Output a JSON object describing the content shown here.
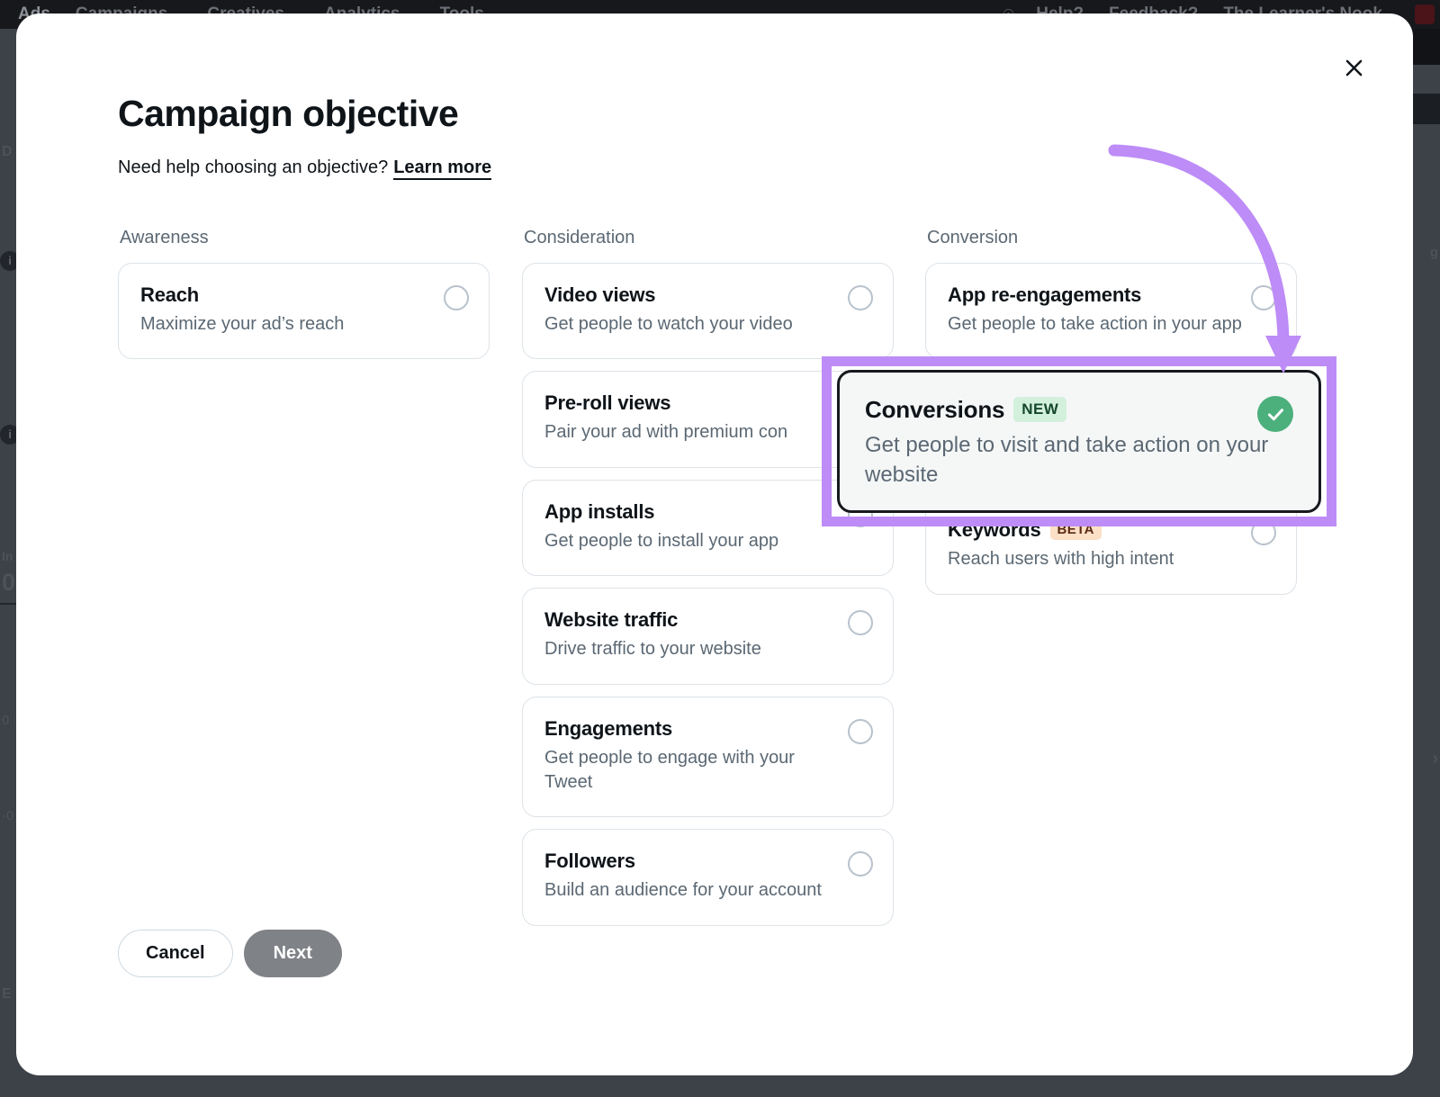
{
  "background": {
    "nav": {
      "brand": "Ads",
      "items": [
        {
          "label": "Campaigns",
          "caret": "⌄"
        },
        {
          "label": "Creatives",
          "caret": "⌄"
        },
        {
          "label": "Analytics",
          "caret": "⌄"
        },
        {
          "label": "Tools",
          "caret": "⌄"
        }
      ],
      "right_items": [
        {
          "label": "Help?",
          "caret": ""
        },
        {
          "label": "Feedback?",
          "caret": ""
        },
        {
          "label": "The Learner's Nook",
          "caret": "⌄"
        }
      ],
      "bell_icon": "bell-icon"
    },
    "left_fragments": [
      "D",
      "In",
      "0",
      "0",
      "-0",
      "E"
    ]
  },
  "modal": {
    "close_icon": "close-icon",
    "title": "Campaign objective",
    "help_text": "Need help choosing an objective?",
    "learn_more": "Learn more",
    "columns": [
      {
        "heading": "Awareness",
        "cards": [
          {
            "title": "Reach",
            "desc": "Maximize your ad’s reach",
            "badge": "",
            "selected": false
          }
        ]
      },
      {
        "heading": "Consideration",
        "cards": [
          {
            "title": "Video views",
            "desc": "Get people to watch your video",
            "badge": "",
            "selected": false
          },
          {
            "title": "Pre-roll views",
            "desc": "Pair your ad with premium con",
            "badge": "",
            "selected": false
          },
          {
            "title": "App installs",
            "desc": "Get people to install your app",
            "badge": "",
            "selected": false
          },
          {
            "title": "Website traffic",
            "desc": "Drive traffic to your website",
            "badge": "",
            "selected": false
          },
          {
            "title": "Engagements",
            "desc": "Get people to engage with your Tweet",
            "badge": "",
            "selected": false
          },
          {
            "title": "Followers",
            "desc": "Build an audience for your account",
            "badge": "",
            "selected": false
          }
        ]
      },
      {
        "heading": "Conversion",
        "cards": [
          {
            "title": "App re-engagements",
            "desc": "Get people to take action in your app",
            "badge": "",
            "selected": false
          },
          {
            "title": "Conversions",
            "desc": "Get people to visit and take action on your website",
            "badge": "NEW",
            "selected": true
          },
          {
            "title": "Keywords",
            "desc": "Reach users with high intent",
            "badge": "BETA",
            "selected": false
          }
        ]
      }
    ],
    "selected_card": {
      "title": "Conversions",
      "badge": "NEW",
      "desc": "Get people to visit and take action on your website",
      "check_icon": "check-icon"
    },
    "footer": {
      "cancel_label": "Cancel",
      "next_label": "Next"
    }
  },
  "annotation": {
    "arrow_color": "#bd8cf7",
    "highlight_color": "#bd8cf7",
    "check_color": "#4cb07c"
  }
}
